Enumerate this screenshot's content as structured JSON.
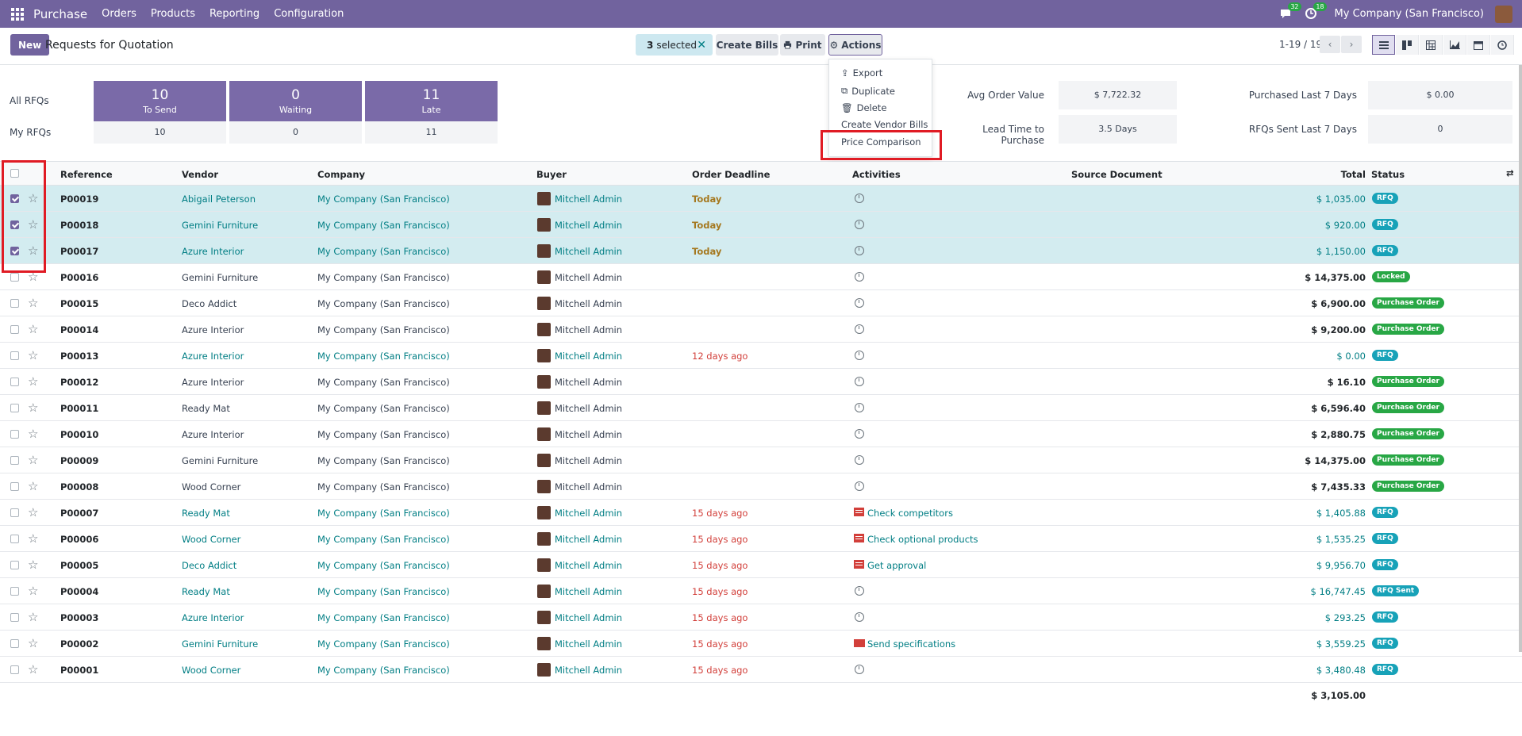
{
  "nav": {
    "app": "Purchase",
    "menu": [
      "Orders",
      "Products",
      "Reporting",
      "Configuration"
    ],
    "chat_count": "32",
    "activity_count": "18",
    "company": "My Company (San Francisco)"
  },
  "control": {
    "new_label": "New",
    "title": "Requests for Quotation",
    "selected_count": "3",
    "selected_text": "selected",
    "create_bills": "Create Bills",
    "print": "Print",
    "actions": "Actions",
    "pager": "1-19 / 19"
  },
  "actions_menu": {
    "export": "Export",
    "duplicate": "Duplicate",
    "delete": "Delete",
    "create_vendor_bills": "Create Vendor Bills",
    "price_comparison": "Price Comparison"
  },
  "dashboard": {
    "all_rfqs": "All RFQs",
    "my_rfqs": "My RFQs",
    "to_send": {
      "value": "10",
      "label": "To Send",
      "mine": "10"
    },
    "waiting": {
      "value": "0",
      "label": "Waiting",
      "mine": "0"
    },
    "late": {
      "value": "11",
      "label": "Late",
      "mine": "11"
    },
    "avg_order_value_label": "Avg Order Value",
    "avg_order_value": "$ 7,722.32",
    "lead_time_label": "Lead Time to Purchase",
    "lead_time": "3.5 Days",
    "purchased_7_label": "Purchased Last 7 Days",
    "purchased_7": "$ 0.00",
    "rfqs_sent_7_label": "RFQs Sent Last 7 Days",
    "rfqs_sent_7": "0"
  },
  "columns": {
    "reference": "Reference",
    "vendor": "Vendor",
    "company": "Company",
    "buyer": "Buyer",
    "deadline": "Order Deadline",
    "activities": "Activities",
    "source": "Source Document",
    "total": "Total",
    "status": "Status"
  },
  "rows": [
    {
      "ref": "P00019",
      "vendor": "Abigail Peterson",
      "company": "My Company (San Francisco)",
      "buyer": "Mitchell Admin",
      "deadline": "Today",
      "activity": "",
      "total": "$ 1,035.00",
      "status": "RFQ"
    },
    {
      "ref": "P00018",
      "vendor": "Gemini Furniture",
      "company": "My Company (San Francisco)",
      "buyer": "Mitchell Admin",
      "deadline": "Today",
      "activity": "",
      "total": "$ 920.00",
      "status": "RFQ"
    },
    {
      "ref": "P00017",
      "vendor": "Azure Interior",
      "company": "My Company (San Francisco)",
      "buyer": "Mitchell Admin",
      "deadline": "Today",
      "activity": "",
      "total": "$ 1,150.00",
      "status": "RFQ"
    },
    {
      "ref": "P00016",
      "vendor": "Gemini Furniture",
      "company": "My Company (San Francisco)",
      "buyer": "Mitchell Admin",
      "deadline": "",
      "activity": "",
      "total": "$ 14,375.00",
      "status": "Locked"
    },
    {
      "ref": "P00015",
      "vendor": "Deco Addict",
      "company": "My Company (San Francisco)",
      "buyer": "Mitchell Admin",
      "deadline": "",
      "activity": "",
      "total": "$ 6,900.00",
      "status": "Purchase Order"
    },
    {
      "ref": "P00014",
      "vendor": "Azure Interior",
      "company": "My Company (San Francisco)",
      "buyer": "Mitchell Admin",
      "deadline": "",
      "activity": "",
      "total": "$ 9,200.00",
      "status": "Purchase Order"
    },
    {
      "ref": "P00013",
      "vendor": "Azure Interior",
      "company": "My Company (San Francisco)",
      "buyer": "Mitchell Admin",
      "deadline": "12 days ago",
      "activity": "",
      "total": "$ 0.00",
      "status": "RFQ"
    },
    {
      "ref": "P00012",
      "vendor": "Azure Interior",
      "company": "My Company (San Francisco)",
      "buyer": "Mitchell Admin",
      "deadline": "",
      "activity": "",
      "total": "$ 16.10",
      "status": "Purchase Order"
    },
    {
      "ref": "P00011",
      "vendor": "Ready Mat",
      "company": "My Company (San Francisco)",
      "buyer": "Mitchell Admin",
      "deadline": "",
      "activity": "",
      "total": "$ 6,596.40",
      "status": "Purchase Order"
    },
    {
      "ref": "P00010",
      "vendor": "Azure Interior",
      "company": "My Company (San Francisco)",
      "buyer": "Mitchell Admin",
      "deadline": "",
      "activity": "",
      "total": "$ 2,880.75",
      "status": "Purchase Order"
    },
    {
      "ref": "P00009",
      "vendor": "Gemini Furniture",
      "company": "My Company (San Francisco)",
      "buyer": "Mitchell Admin",
      "deadline": "",
      "activity": "",
      "total": "$ 14,375.00",
      "status": "Purchase Order"
    },
    {
      "ref": "P00008",
      "vendor": "Wood Corner",
      "company": "My Company (San Francisco)",
      "buyer": "Mitchell Admin",
      "deadline": "",
      "activity": "",
      "total": "$ 7,435.33",
      "status": "Purchase Order"
    },
    {
      "ref": "P00007",
      "vendor": "Ready Mat",
      "company": "My Company (San Francisco)",
      "buyer": "Mitchell Admin",
      "deadline": "15 days ago",
      "activity": "Check competitors",
      "total": "$ 1,405.88",
      "status": "RFQ"
    },
    {
      "ref": "P00006",
      "vendor": "Wood Corner",
      "company": "My Company (San Francisco)",
      "buyer": "Mitchell Admin",
      "deadline": "15 days ago",
      "activity": "Check optional products",
      "total": "$ 1,535.25",
      "status": "RFQ"
    },
    {
      "ref": "P00005",
      "vendor": "Deco Addict",
      "company": "My Company (San Francisco)",
      "buyer": "Mitchell Admin",
      "deadline": "15 days ago",
      "activity": "Get approval",
      "total": "$ 9,956.70",
      "status": "RFQ"
    },
    {
      "ref": "P00004",
      "vendor": "Ready Mat",
      "company": "My Company (San Francisco)",
      "buyer": "Mitchell Admin",
      "deadline": "15 days ago",
      "activity": "",
      "total": "$ 16,747.45",
      "status": "RFQ Sent"
    },
    {
      "ref": "P00003",
      "vendor": "Azure Interior",
      "company": "My Company (San Francisco)",
      "buyer": "Mitchell Admin",
      "deadline": "15 days ago",
      "activity": "",
      "total": "$ 293.25",
      "status": "RFQ"
    },
    {
      "ref": "P00002",
      "vendor": "Gemini Furniture",
      "company": "My Company (San Francisco)",
      "buyer": "Mitchell Admin",
      "deadline": "15 days ago",
      "activity": "Send specifications",
      "total": "$ 3,559.25",
      "status": "RFQ"
    },
    {
      "ref": "P00001",
      "vendor": "Wood Corner",
      "company": "My Company (San Francisco)",
      "buyer": "Mitchell Admin",
      "deadline": "15 days ago",
      "activity": "",
      "total": "$ 3,480.48",
      "status": "RFQ"
    }
  ],
  "grand_total": "$ 3,105.00",
  "colors": {
    "brand": "#71639e",
    "link": "#017e84",
    "late": "#d23f3a",
    "today": "#a5781f",
    "rfq": "#17a2b8",
    "po": "#28a745"
  }
}
